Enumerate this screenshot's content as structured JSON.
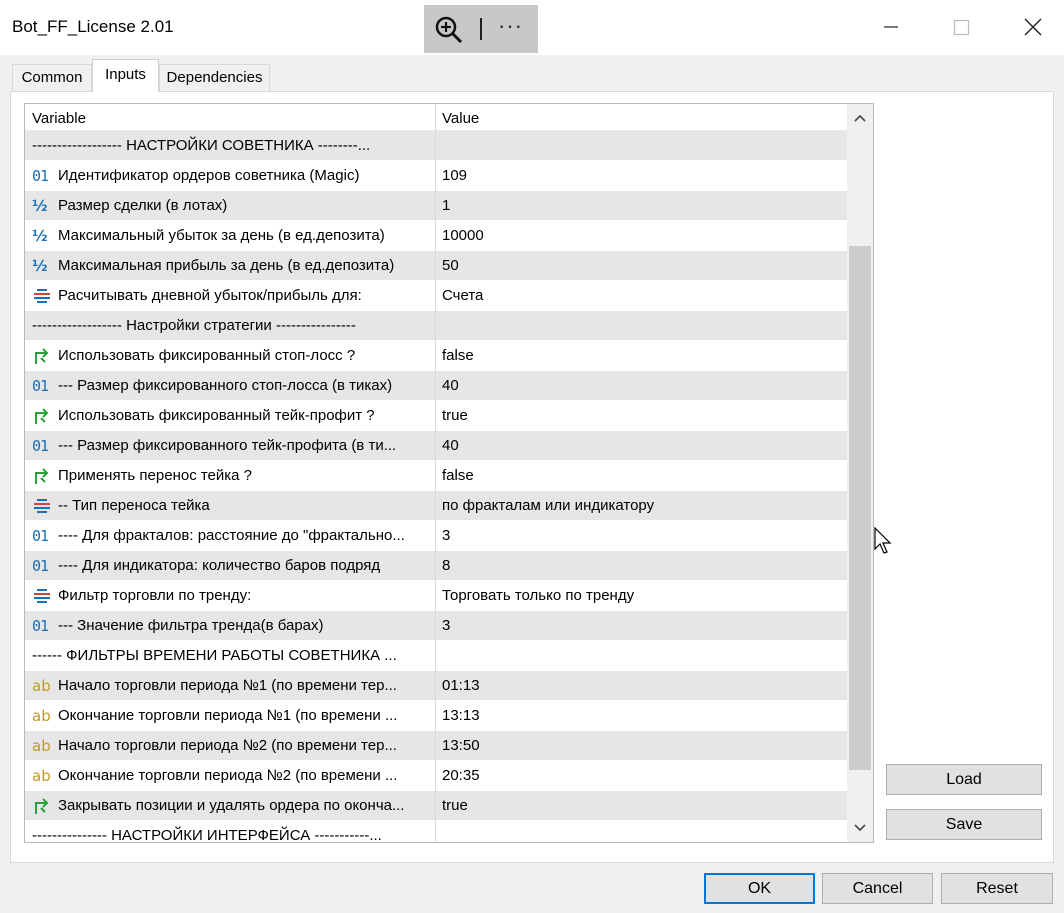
{
  "window": {
    "title": "Bot_FF_License 2.01",
    "zoom_more": "···"
  },
  "tabs": [
    {
      "label": "Common"
    },
    {
      "label": "Inputs"
    },
    {
      "label": "Dependencies"
    }
  ],
  "grid": {
    "col_variable": "Variable",
    "col_value": "Value",
    "rows": [
      {
        "type": "header",
        "variable": "------------------   НАСТРОЙКИ СОВЕТНИКА    --------...",
        "value": ""
      },
      {
        "type": "int",
        "icon": "01",
        "variable": "Идентификатор ордеров советника (Magic)",
        "value": "109"
      },
      {
        "type": "double",
        "icon": "½",
        "variable": "Размер сделки (в лотах)",
        "value": "1"
      },
      {
        "type": "double",
        "icon": "½",
        "variable": "Максимальный убыток за день (в ед.депозита)",
        "value": "10000"
      },
      {
        "type": "double",
        "icon": "½",
        "variable": "Максимальная прибыль за день (в ед.депозита)",
        "value": "50"
      },
      {
        "type": "enum",
        "icon": "",
        "variable": "Расчитывать дневной убыток/прибыль для:",
        "value": "Счета"
      },
      {
        "type": "header",
        "variable": "------------------   Настройки стратегии    ----------------",
        "value": ""
      },
      {
        "type": "bool",
        "icon": "",
        "variable": "Использовать фиксированный стоп-лосс ?",
        "value": "false"
      },
      {
        "type": "int",
        "icon": "01",
        "variable": "--- Размер фиксированного стоп-лосса (в тиках)",
        "value": "40"
      },
      {
        "type": "bool",
        "icon": "",
        "variable": "Использовать фиксированный тейк-профит ?",
        "value": "true"
      },
      {
        "type": "int",
        "icon": "01",
        "variable": "--- Размер фиксированного тейк-профита (в ти...",
        "value": "40"
      },
      {
        "type": "bool",
        "icon": "",
        "variable": "Применять перенос тейка ?",
        "value": "false"
      },
      {
        "type": "enum",
        "icon": "",
        "variable": "-- Тип переноса тейка",
        "value": "по фракталам или индикатору"
      },
      {
        "type": "int",
        "icon": "01",
        "variable": "---- Для фракталов: расстояние до \"фрактально...",
        "value": "3"
      },
      {
        "type": "int",
        "icon": "01",
        "variable": "---- Для индикатора: количество баров подряд",
        "value": "8"
      },
      {
        "type": "enum",
        "icon": "",
        "variable": "Фильтр торговли по тренду:",
        "value": "Торговать только по тренду"
      },
      {
        "type": "int",
        "icon": "01",
        "variable": "--- Значение фильтра тренда(в барах)",
        "value": "3"
      },
      {
        "type": "header",
        "variable": "------    ФИЛЬТРЫ ВРЕМЕНИ РАБОТЫ СОВЕТНИКА    ...",
        "value": ""
      },
      {
        "type": "string",
        "icon": "ab",
        "variable": "Начало торговли периода №1 (по времени тер...",
        "value": "01:13"
      },
      {
        "type": "string",
        "icon": "ab",
        "variable": "Окончание торговли периода №1 (по времени ...",
        "value": "13:13"
      },
      {
        "type": "string",
        "icon": "ab",
        "variable": "Начало торговли периода №2 (по времени тер...",
        "value": "13:50"
      },
      {
        "type": "string",
        "icon": "ab",
        "variable": "Окончание торговли периода №2 (по времени ...",
        "value": "20:35"
      },
      {
        "type": "bool",
        "icon": "",
        "variable": "Закрывать позиции и удалять ордера по оконча...",
        "value": "true"
      },
      {
        "type": "header",
        "variable": "---------------    НАСТРОЙКИ ИНТЕРФЕЙСА    -----------...",
        "value": ""
      }
    ]
  },
  "buttons": {
    "load": "Load",
    "save": "Save",
    "ok": "OK",
    "cancel": "Cancel",
    "reset": "Reset"
  },
  "colors": {
    "int_icon": "#1a6fb8",
    "bool_icon": "#2aa13a",
    "enum_icon_blue": "#1a6fb8",
    "enum_icon_red": "#d0453a",
    "string_icon": "#c09a2a",
    "row_shade": "#e6e6e6",
    "ok_border": "#0078d7"
  }
}
